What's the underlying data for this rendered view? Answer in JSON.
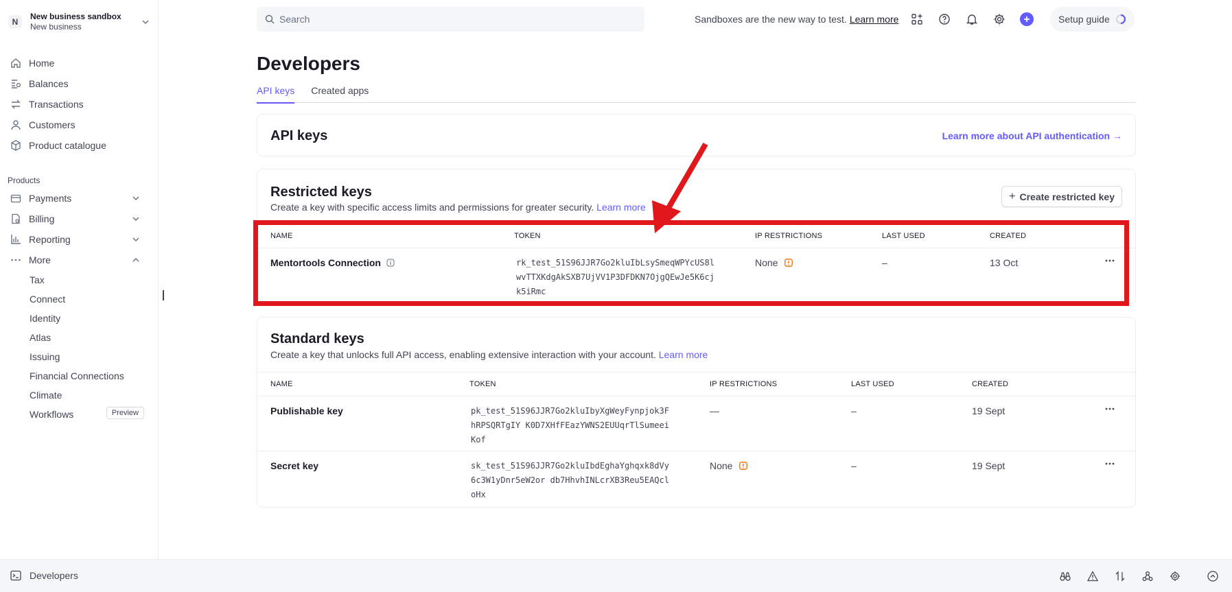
{
  "account": {
    "initial": "N",
    "name": "New business sandbox",
    "subtitle": "New business"
  },
  "sidebar": {
    "main_items": [
      {
        "label": "Home",
        "icon": "home-icon"
      },
      {
        "label": "Balances",
        "icon": "balances-icon"
      },
      {
        "label": "Transactions",
        "icon": "transactions-icon"
      },
      {
        "label": "Customers",
        "icon": "customers-icon"
      },
      {
        "label": "Product catalogue",
        "icon": "product-catalogue-icon"
      }
    ],
    "products_label": "Products",
    "product_items": [
      {
        "label": "Payments",
        "icon": "payments-icon"
      },
      {
        "label": "Billing",
        "icon": "billing-icon"
      },
      {
        "label": "Reporting",
        "icon": "reporting-icon"
      },
      {
        "label": "More",
        "icon": "more-dots-icon"
      }
    ],
    "more_items": [
      "Tax",
      "Connect",
      "Identity",
      "Atlas",
      "Issuing",
      "Financial Connections",
      "Climate",
      "Workflows"
    ],
    "workflows_badge": "Preview"
  },
  "topbar": {
    "search_placeholder": "Search",
    "sandbox_message": "Sandboxes are the new way to test.",
    "sandbox_link": "Learn more",
    "setup_guide": "Setup guide"
  },
  "page": {
    "title": "Developers",
    "tabs": [
      "API keys",
      "Created apps"
    ]
  },
  "api_keys_card": {
    "title": "API keys",
    "link": "Learn more about API authentication →"
  },
  "restricted": {
    "title": "Restricted keys",
    "description": "Create a key with specific access limits and permissions for greater security.",
    "learn_more": "Learn more",
    "create_button": "Create restricted key",
    "columns": [
      "NAME",
      "TOKEN",
      "IP RESTRICTIONS",
      "LAST USED",
      "CREATED"
    ],
    "rows": [
      {
        "name": "Mentortools Connection",
        "token": "rk_test_51S96JJR7Go2kluIbLsySmeqWPYcUS8lwvTTXKdgAkSXB7UjVV1P3DFDKN7OjgQEwJe5K6cjk5iRmc",
        "ip": "None",
        "last_used": "–",
        "created": "13 Oct"
      }
    ]
  },
  "standard": {
    "title": "Standard keys",
    "description": "Create a key that unlocks full API access, enabling extensive interaction with your account.",
    "learn_more": "Learn more",
    "columns": [
      "NAME",
      "TOKEN",
      "IP RESTRICTIONS",
      "LAST USED",
      "CREATED"
    ],
    "rows": [
      {
        "name": "Publishable key",
        "token": "pk_test_51S96JJR7Go2kluIbyXgWeyFynpjok3FhRPSQRTgIY      K0D7XHfFEazYWNS2EUUqrTlSumeeiKof",
        "ip": "—",
        "last_used": "–",
        "created": "19 Sept"
      },
      {
        "name": "Secret key",
        "token": "sk_test_51S96JJR7Go2kluIbdEghaYghqxk8dVy6c3W1yDnr5eW2or               db7HhvhINLcrXB3Reu5EAQcloHx",
        "ip": "None",
        "last_used": "–",
        "created": "19 Sept"
      }
    ]
  },
  "bottombar": {
    "label": "Developers"
  },
  "colors": {
    "accent": "#635bff",
    "annotation": "#e0181b",
    "warning": "#e66e00"
  }
}
